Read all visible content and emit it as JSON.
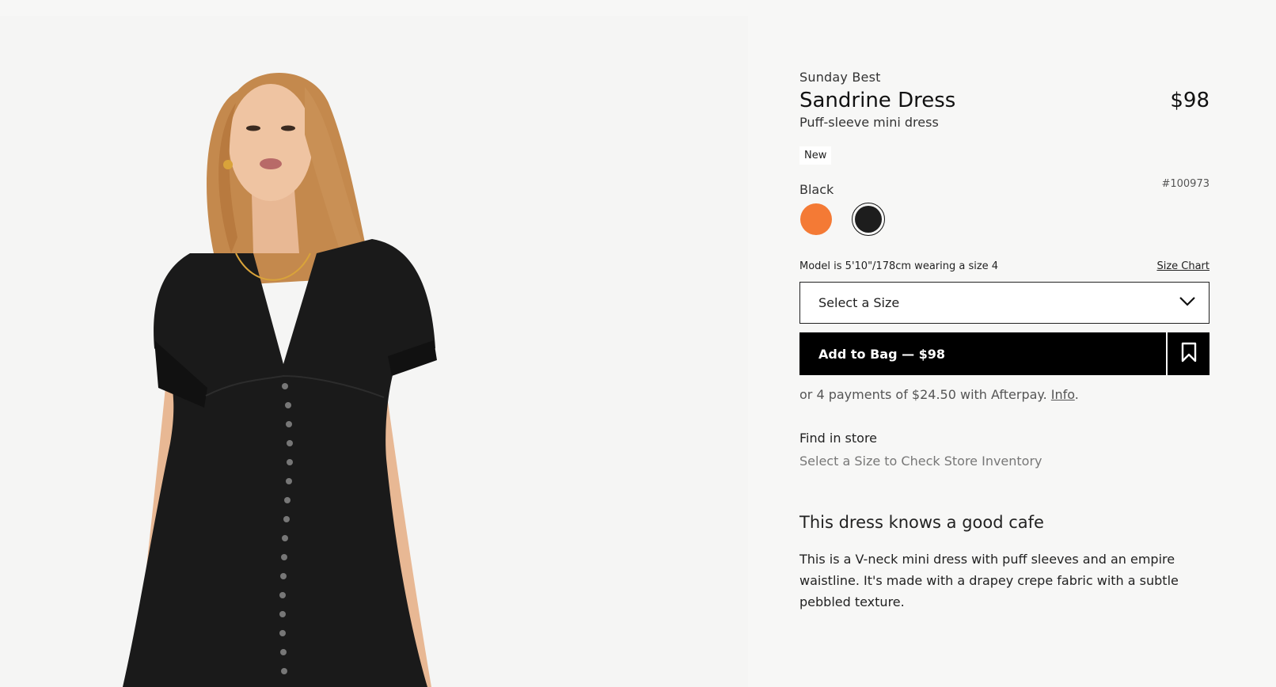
{
  "product": {
    "collection": "Sunday Best",
    "title": "Sandrine Dress",
    "price": "$98",
    "subtitle": "Puff-sleeve mini dress",
    "badge": "New",
    "sku": "#100973",
    "image_alt": "Model wearing black puff-sleeve mini dress"
  },
  "colors": {
    "selected_label": "Black",
    "swatches": [
      {
        "name": "Orange",
        "hex": "#f47a35",
        "selected": false
      },
      {
        "name": "Black",
        "hex": "#1d1d1d",
        "selected": true
      }
    ]
  },
  "sizing": {
    "model_note": "Model is 5'10\"/178cm wearing a size 4",
    "size_chart": "Size Chart",
    "select_placeholder": "Select a Size"
  },
  "purchase": {
    "add_to_bag": "Add to Bag — $98",
    "afterpay_text": "or 4 payments of $24.50 with Afterpay.",
    "afterpay_info": "Info",
    "afterpay_period": "."
  },
  "store": {
    "title": "Find in store",
    "subtitle": "Select a Size to Check Store Inventory"
  },
  "description": {
    "heading": "This dress knows a good cafe",
    "body": "This is a V-neck mini dress with puff sleeves and an empire waistline. It's made with a drapey crepe fabric with a subtle pebbled texture."
  },
  "icons": {
    "dropdown": "chevron-down-icon",
    "save": "bookmark-icon"
  },
  "theme": {
    "button_bg": "#000000",
    "page_bg": "#f7f7f6"
  }
}
